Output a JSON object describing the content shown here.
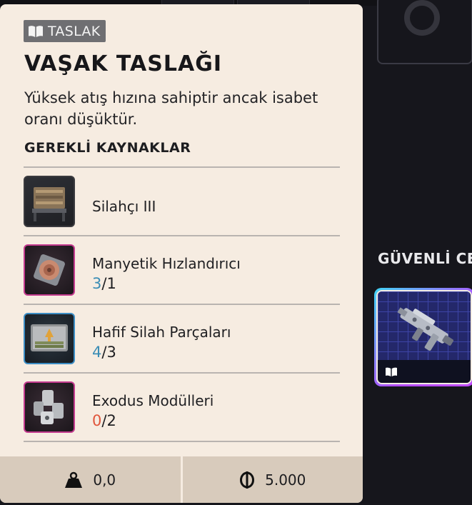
{
  "tooltip": {
    "tag_label": "TASLAK",
    "title": "VAŞAK TASLAĞI",
    "description": "Yüksek atış hızına sahiptir ancak isabet oranı düşüktür.",
    "requirements_header": "GEREKLİ KAYNAKLAR",
    "requirements": [
      {
        "name": "Silahçı III",
        "have": "",
        "need": "",
        "icon": "workbench-icon",
        "rarity": "common"
      },
      {
        "name": "Manyetik Hızlandırıcı",
        "have": "3",
        "need": "1",
        "icon": "magnetic-accelerator-icon",
        "rarity": "epic"
      },
      {
        "name": "Hafif Silah Parçaları",
        "have": "4",
        "need": "3",
        "icon": "weapon-parts-case-icon",
        "rarity": "rare"
      },
      {
        "name": "Exodus Modülleri",
        "have": "0",
        "need": "2",
        "icon": "exodus-modules-icon",
        "rarity": "epic"
      }
    ],
    "footer": {
      "weight_value": "0,0",
      "weight_icon": "weight-icon",
      "price_value": "5.000",
      "price_icon": "coin-icon"
    }
  },
  "side": {
    "section_header": "GÜVENLİ CE",
    "item_card_icon": "book-icon"
  },
  "colors": {
    "panel_bg": "#f6ece1",
    "have_ok": "#3b8db5",
    "have_missing": "#e0553b",
    "epic_border": "#c43b8f",
    "rare_border": "#3b8dc4"
  }
}
